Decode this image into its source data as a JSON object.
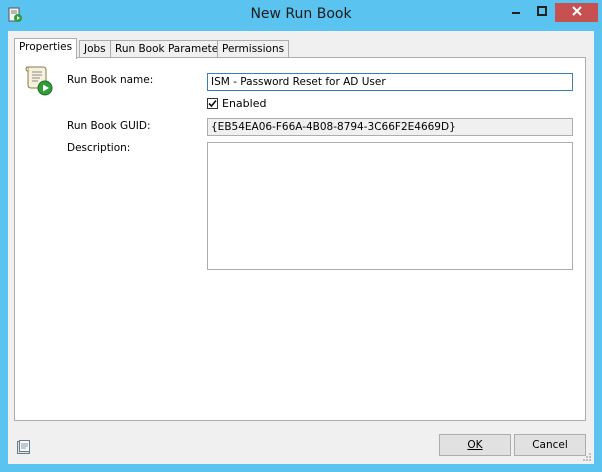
{
  "window": {
    "title": "New Run Book",
    "app_icon": "runbook-app-icon",
    "controls": {
      "minimize": "minimize-icon",
      "maximize": "maximize-icon",
      "close": "close-icon"
    }
  },
  "tabs": [
    {
      "label": "Properties",
      "active": true
    },
    {
      "label": "Jobs",
      "active": false
    },
    {
      "label": "Run Book Parameters",
      "active": false
    },
    {
      "label": "Permissions",
      "active": false
    }
  ],
  "properties": {
    "icon": "runbook-scroll-play-icon",
    "name_label": "Run Book name:",
    "name_value": "ISM - Password Reset for AD User",
    "enabled_label": "Enabled",
    "enabled_checked": true,
    "guid_label": "Run Book GUID:",
    "guid_value": "{EB54EA06-F66A-4B08-8794-3C66F2E4669D}",
    "description_label": "Description:",
    "description_value": ""
  },
  "footer": {
    "icon": "runbook-properties-icon",
    "ok_label": "OK",
    "cancel_label": "Cancel"
  },
  "colors": {
    "title_bar": "#5bc3f0",
    "close_button": "#c75050",
    "dialog_bg": "#f0f0f0"
  }
}
